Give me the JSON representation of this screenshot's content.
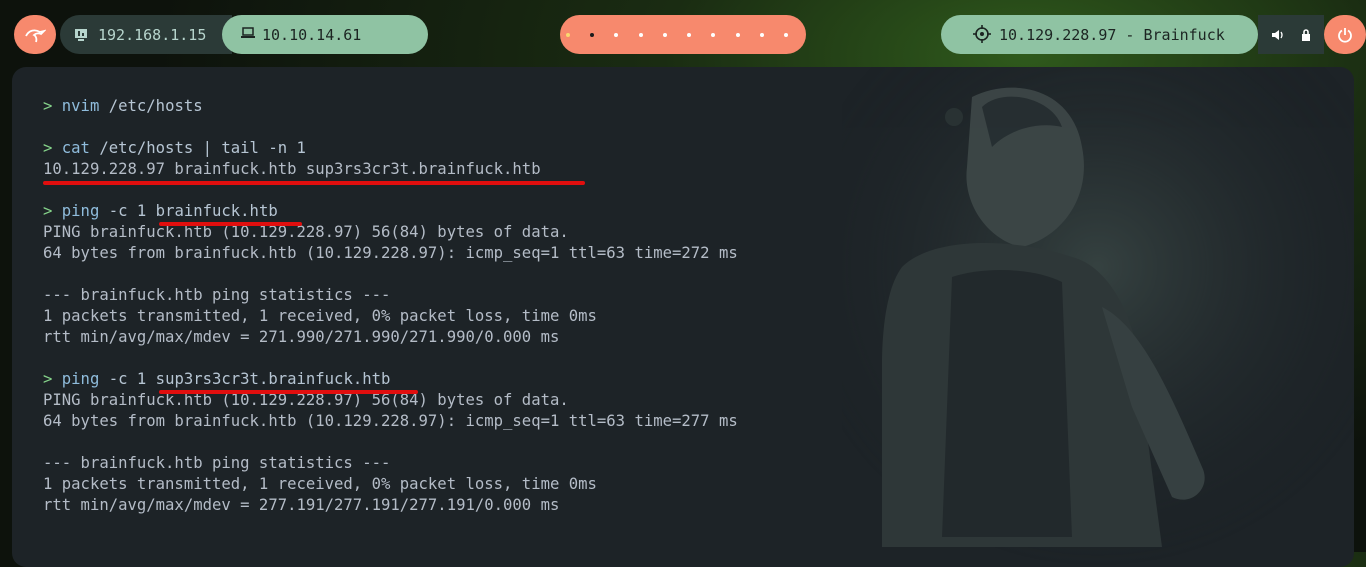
{
  "topbar": {
    "local_ip": "192.168.1.15",
    "vpn_ip": "10.10.14.61",
    "target": "10.129.228.97 - Brainfuck",
    "workspace_count": 10,
    "active_workspace": 2,
    "icons": [
      "kali-dragon-icon",
      "monitor-icon",
      "laptop-icon",
      "crosshair-icon",
      "speaker-icon",
      "lock-icon",
      "power-icon"
    ],
    "colors": {
      "salmon": "#f7896d",
      "mint": "#8fc3a3",
      "dark": "#2b3a37"
    }
  },
  "terminal": {
    "prompt_symbol": ">",
    "blocks": [
      {
        "cmd": "nvim",
        "args": "/etc/hosts",
        "output": []
      },
      {
        "cmd": "cat",
        "args": "/etc/hosts | tail -n 1",
        "output": [
          "10.129.228.97 brainfuck.htb sup3rs3cr3t.brainfuck.htb"
        ]
      },
      {
        "cmd": "ping",
        "args": "-c 1 brainfuck.htb",
        "output": [
          "PING brainfuck.htb (10.129.228.97) 56(84) bytes of data.",
          "64 bytes from brainfuck.htb (10.129.228.97): icmp_seq=1 ttl=63 time=272 ms",
          "",
          "--- brainfuck.htb ping statistics ---",
          "1 packets transmitted, 1 received, 0% packet loss, time 0ms",
          "rtt min/avg/max/mdev = 271.990/271.990/271.990/0.000 ms"
        ]
      },
      {
        "cmd": "ping",
        "args": "-c 1 sup3rs3cr3t.brainfuck.htb",
        "output": [
          "PING brainfuck.htb (10.129.228.97) 56(84) bytes of data.",
          "64 bytes from brainfuck.htb (10.129.228.97): icmp_seq=1 ttl=63 time=277 ms",
          "",
          "--- brainfuck.htb ping statistics ---",
          "1 packets transmitted, 1 received, 0% packet loss, time 0ms",
          "rtt min/avg/max/mdev = 277.191/277.191/277.191/0.000 ms"
        ]
      }
    ]
  }
}
